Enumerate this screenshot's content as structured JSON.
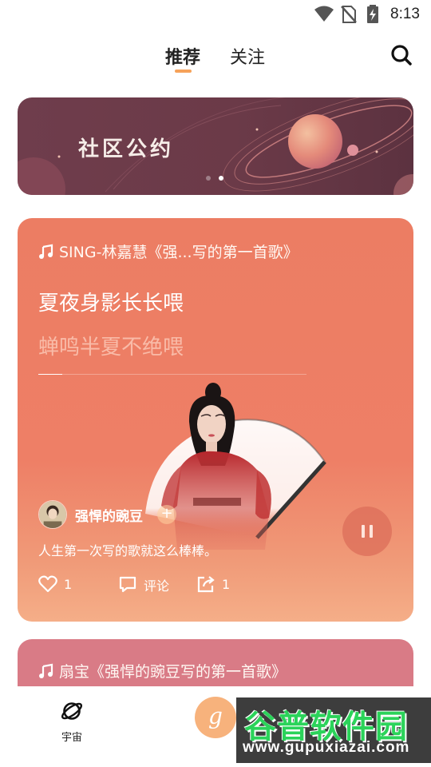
{
  "status_bar": {
    "time": "8:13",
    "icons": [
      "wifi-icon",
      "no-sim-icon",
      "battery-charging-icon"
    ]
  },
  "top_nav": {
    "tabs": [
      {
        "label": "推荐",
        "active": true
      },
      {
        "label": "关注",
        "active": false
      }
    ],
    "search_icon": "search-icon",
    "accent_color": "#f6a25a"
  },
  "banner": {
    "title": "社区公约",
    "page_count": 2,
    "active_page": 2
  },
  "feed": [
    {
      "song_title": "SING-林嘉慧《强...写的第一首歌》",
      "lyric_current": "夏夜身影长长喂",
      "lyric_next": "蝉鸣半夏不绝喂",
      "progress": 0.09,
      "user": {
        "name": "强悍的豌豆",
        "follow_label": "+"
      },
      "caption": "人生第一次写的歌就这么棒棒。",
      "likes": "1",
      "comment_label": "评论",
      "shares": "1",
      "playing": true,
      "card_color": "#ec7d63"
    },
    {
      "song_title": "扇宝《强悍的豌豆写的第一首歌》",
      "card_color": "#d97b86"
    }
  ],
  "bottom_nav": {
    "items": [
      {
        "label": "宇宙",
        "icon": "planet-icon"
      }
    ],
    "fab_label": "g"
  },
  "watermark": {
    "name": "谷普软件园",
    "url": "www.gupuxiazai.com"
  }
}
